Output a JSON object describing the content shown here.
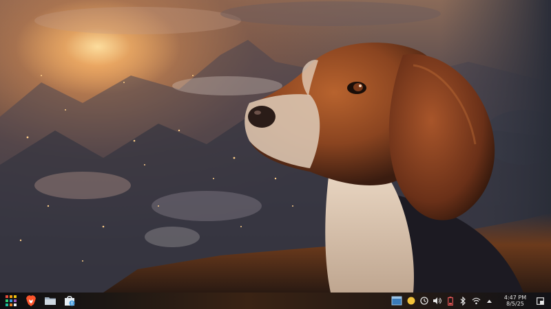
{
  "desktop": {
    "wallpaper": "beagle-on-mountain-sunset"
  },
  "taskbar": {
    "launcher_icon": "app-grid-icon",
    "pinned_apps": [
      {
        "name": "brave-browser",
        "icon": "brave-lion-icon",
        "color": "#fb542b"
      },
      {
        "name": "file-manager",
        "icon": "folder-icon",
        "color": "#cfd8e0"
      },
      {
        "name": "software-store",
        "icon": "store-bag-icon",
        "color": "#4a9fe0"
      }
    ],
    "tray": [
      {
        "name": "desktop-pager",
        "icon": "window-icon"
      },
      {
        "name": "notes",
        "icon": "sticky-note-icon",
        "color": "#f2c23a"
      },
      {
        "name": "updates",
        "icon": "update-icon"
      },
      {
        "name": "volume",
        "icon": "speaker-icon"
      },
      {
        "name": "battery",
        "icon": "battery-icon",
        "color": "#e05555"
      },
      {
        "name": "bluetooth",
        "icon": "bluetooth-icon"
      },
      {
        "name": "network",
        "icon": "wifi-icon"
      },
      {
        "name": "tray-expander",
        "icon": "chevron-up-icon"
      }
    ],
    "clock": {
      "time": "4:47 PM",
      "date": "8/5/25"
    }
  }
}
